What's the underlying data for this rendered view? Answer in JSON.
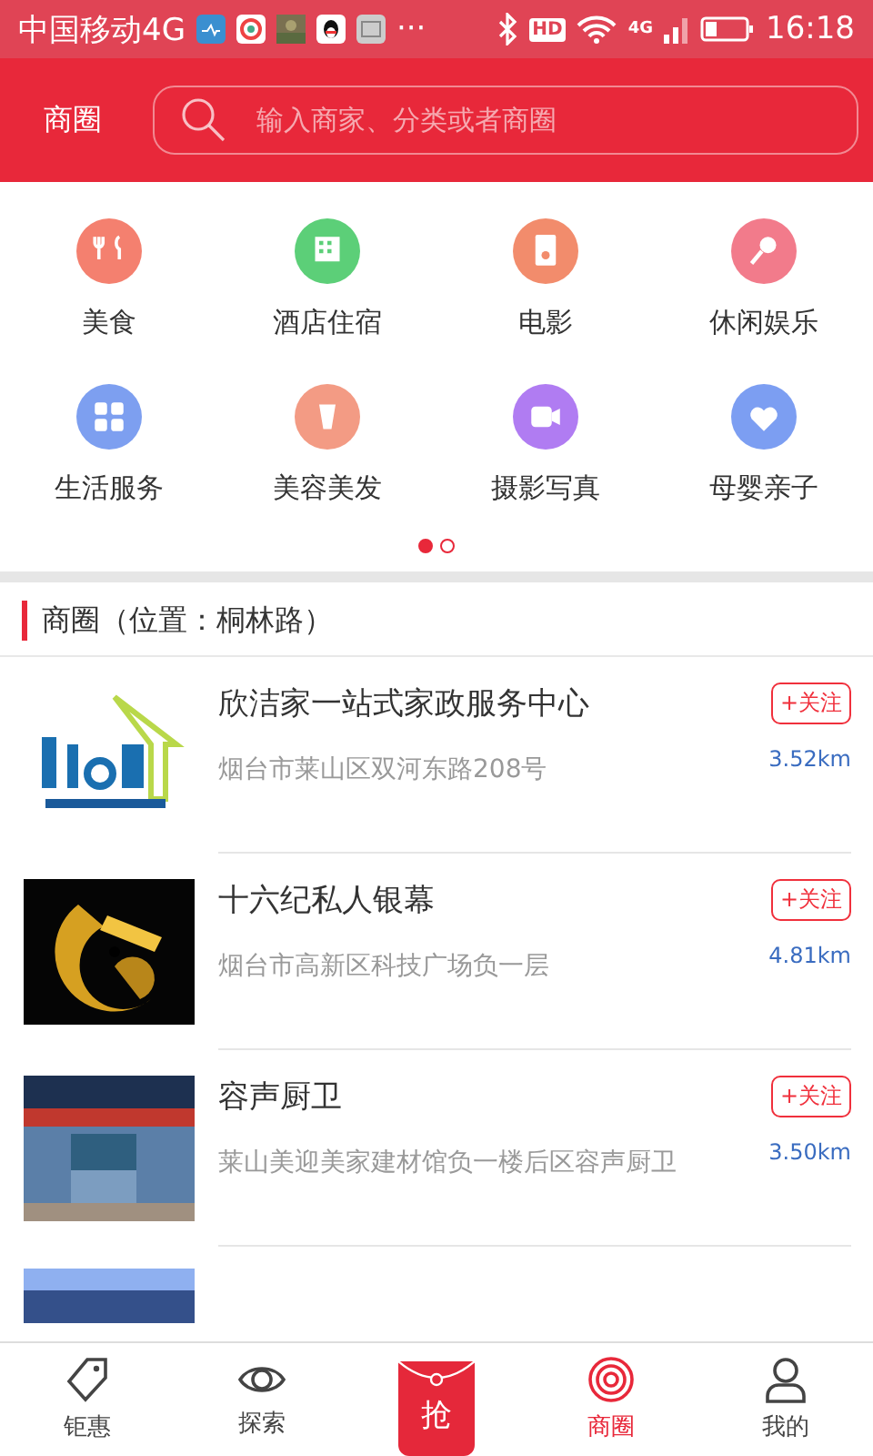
{
  "status_bar": {
    "carrier": "中国移动4G",
    "more": "···",
    "hd": "HD",
    "network": "4G",
    "time": "16:18"
  },
  "header": {
    "title": "商圈",
    "search": {
      "placeholder": "输入商家、分类或者商圈"
    }
  },
  "categories": [
    {
      "label": "美食",
      "color": "#f4806f"
    },
    {
      "label": "酒店住宿",
      "color": "#5ccf78"
    },
    {
      "label": "电影",
      "color": "#f28c6c"
    },
    {
      "label": "休闲娱乐",
      "color": "#f27b8b"
    },
    {
      "label": "生活服务",
      "color": "#7d9ff0"
    },
    {
      "label": "美容美发",
      "color": "#f39b84"
    },
    {
      "label": "摄影写真",
      "color": "#b07cf2"
    },
    {
      "label": "母婴亲子",
      "color": "#7c9ef2"
    }
  ],
  "pager": [
    {
      "selected": true
    },
    {
      "selected": false
    }
  ],
  "section": {
    "title": "商圈（位置：桐林路）"
  },
  "merchants": [
    {
      "name": "欣洁家一站式家政服务中心",
      "address": "烟台市莱山区双河东路208号",
      "follow": "+关注",
      "distance": "3.52km"
    },
    {
      "name": "十六纪私人银幕",
      "address": "烟台市高新区科技广场负一层",
      "follow": "+关注",
      "distance": "4.81km"
    },
    {
      "name": "容声厨卫",
      "address": "莱山美迎美家建材馆负一楼后区容声厨卫",
      "follow": "+关注",
      "distance": "3.50km"
    }
  ],
  "bottom_nav": [
    {
      "label": "钜惠",
      "kind": "tag",
      "selected": false
    },
    {
      "label": "探索",
      "kind": "eye",
      "selected": false
    },
    {
      "label": "抢",
      "kind": "center",
      "selected": false
    },
    {
      "label": "商圈",
      "kind": "rings",
      "selected": true
    },
    {
      "label": "我的",
      "kind": "person",
      "selected": false
    }
  ]
}
